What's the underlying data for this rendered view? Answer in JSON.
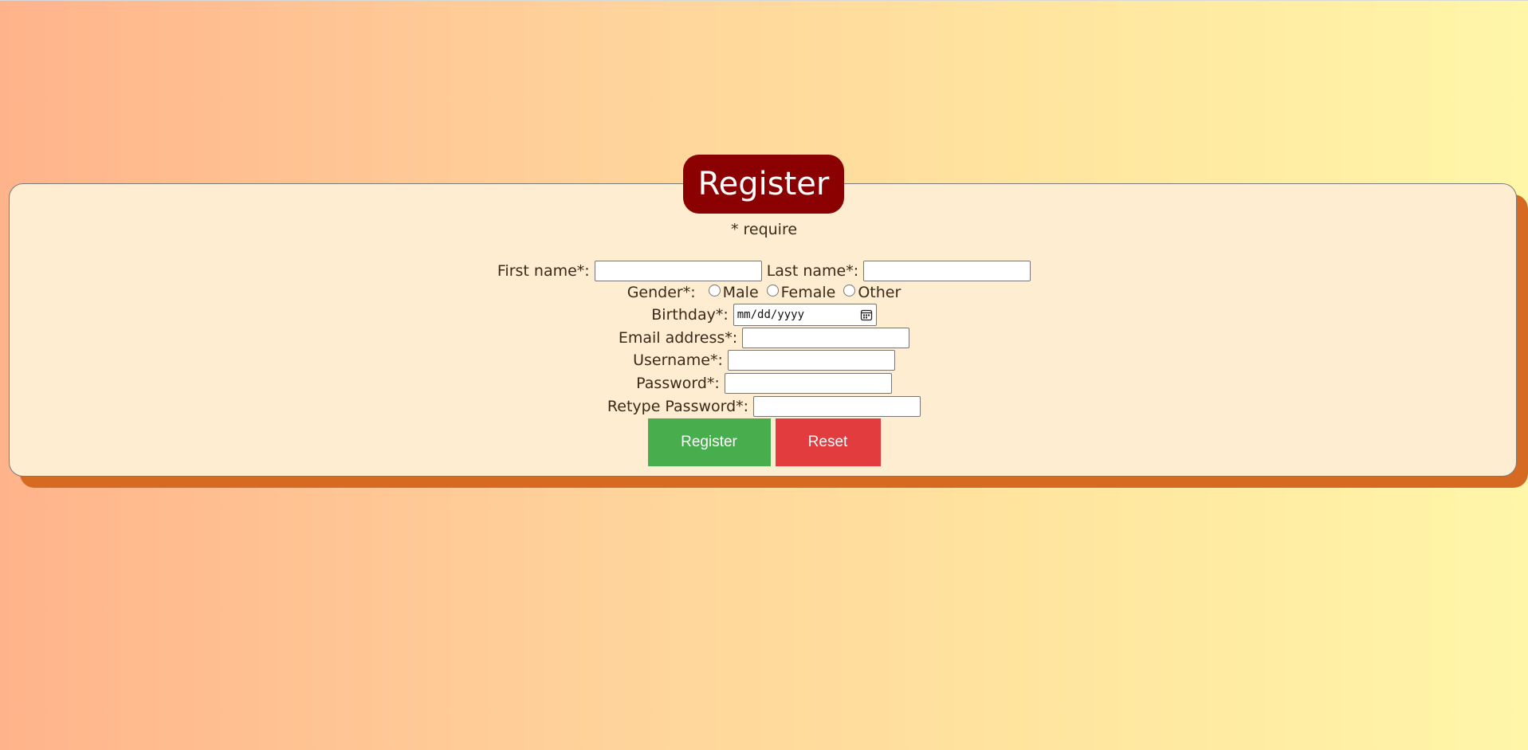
{
  "header": {
    "title": "Register"
  },
  "form": {
    "require_note": "* require",
    "first_name_label": "First name*:",
    "last_name_label": "Last name*:",
    "gender_label": "Gender*:",
    "gender_options": [
      "Male",
      "Female",
      "Other"
    ],
    "birthday_label": "Birthday*:",
    "birthday_placeholder": "mm/dd/yyyy",
    "email_label": "Email address*:",
    "username_label": "Username*:",
    "password_label": "Password*:",
    "retype_password_label": "Retype Password*:",
    "first_name_value": "",
    "last_name_value": "",
    "email_value": "",
    "username_value": "",
    "password_value": "",
    "retype_password_value": ""
  },
  "buttons": {
    "register_label": "Register",
    "reset_label": "Reset"
  },
  "colors": {
    "title_bg": "#8b0000",
    "panel_bg": "#ffedd1",
    "shadow": "#d66a22",
    "register_button": "#47ad4d",
    "reset_button": "#e23c3f"
  },
  "icons": {
    "birthday_picker": "calendar-icon"
  }
}
